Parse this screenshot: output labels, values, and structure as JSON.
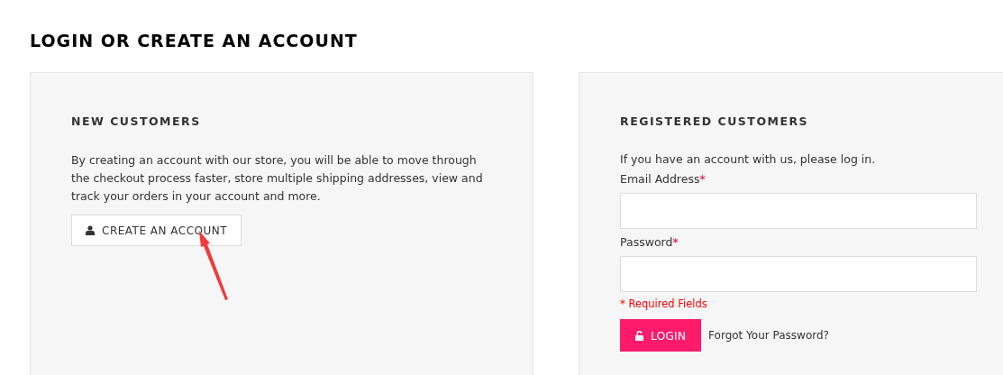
{
  "page_title": "LOGIN OR CREATE AN ACCOUNT",
  "new_customers": {
    "heading": "NEW CUSTOMERS",
    "text": "By creating an account with our store, you will be able to move through the checkout process faster, store multiple shipping addresses, view and track your orders in your account and more.",
    "button": "CREATE AN ACCOUNT"
  },
  "registered_customers": {
    "heading": "REGISTERED CUSTOMERS",
    "intro": "If you have an account with us, please log in.",
    "fields": [
      {
        "label": "Email Address",
        "required_mark": "*"
      },
      {
        "label": "Password",
        "required_mark": "*"
      }
    ],
    "required_note": "* Required Fields",
    "button": "LOGIN",
    "link": "Forgot Your Password?"
  }
}
